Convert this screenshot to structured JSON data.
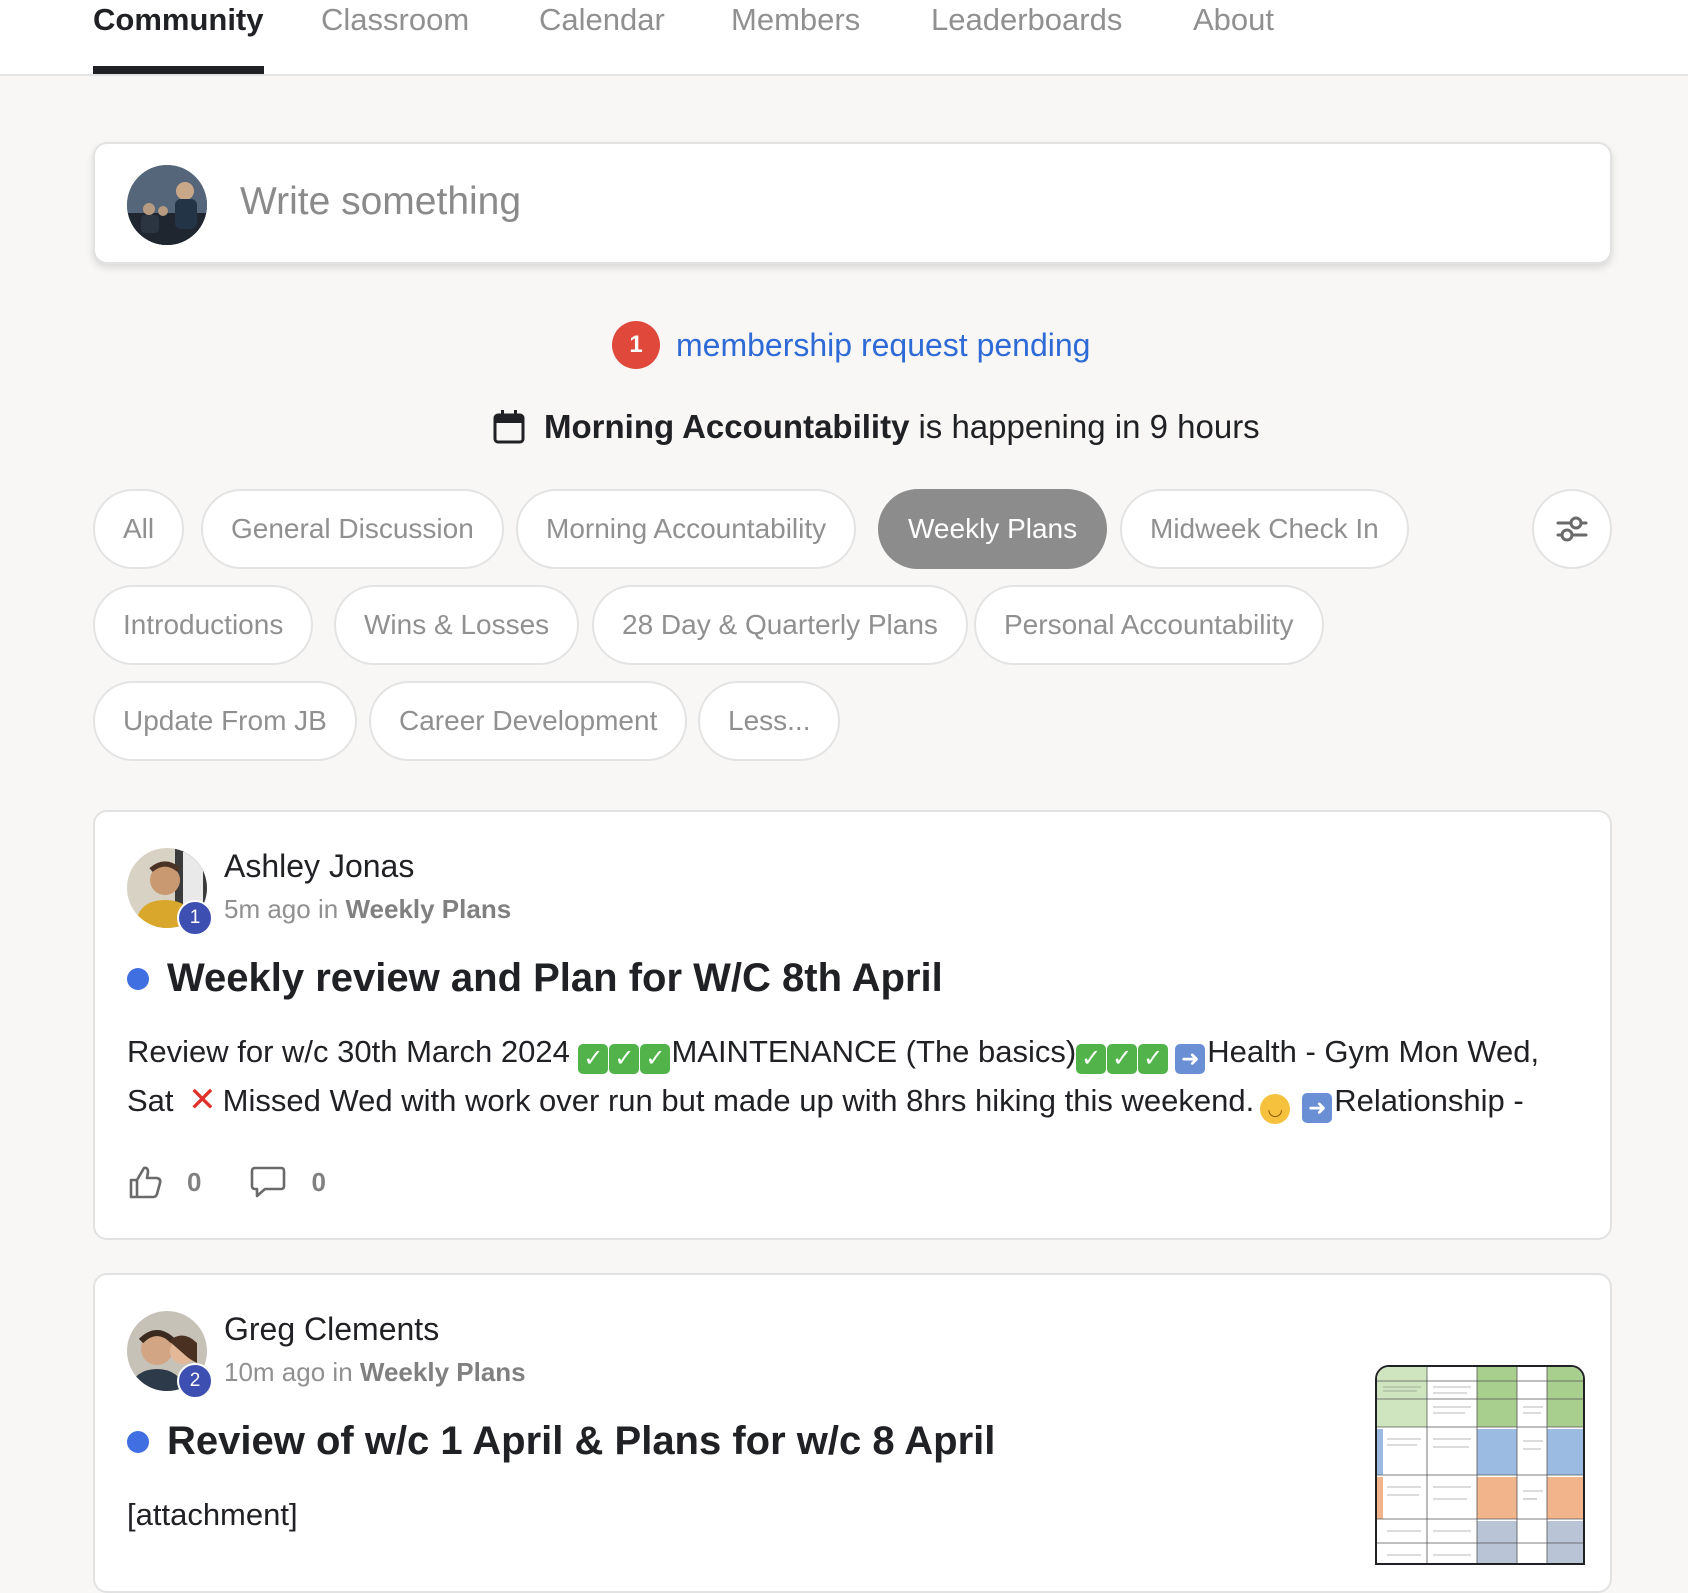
{
  "nav": {
    "tabs": [
      {
        "label": "Community",
        "active": true
      },
      {
        "label": "Classroom",
        "active": false
      },
      {
        "label": "Calendar",
        "active": false
      },
      {
        "label": "Members",
        "active": false
      },
      {
        "label": "Leaderboards",
        "active": false
      },
      {
        "label": "About",
        "active": false
      }
    ]
  },
  "composer": {
    "placeholder": "Write something"
  },
  "pending": {
    "count": "1",
    "text": "membership request pending"
  },
  "event": {
    "name": "Morning Accountability",
    "text": "is happening in 9 hours"
  },
  "categories": [
    {
      "label": "All",
      "active": false
    },
    {
      "label": "General Discussion",
      "active": false
    },
    {
      "label": "Morning Accountability",
      "active": false
    },
    {
      "label": "Weekly Plans",
      "active": true
    },
    {
      "label": "Midweek Check In",
      "active": false
    },
    {
      "label": "Introductions",
      "active": false
    },
    {
      "label": "Wins & Losses",
      "active": false
    },
    {
      "label": "28 Day & Quarterly Plans",
      "active": false
    },
    {
      "label": "Personal Accountability",
      "active": false
    },
    {
      "label": "Update From JB",
      "active": false
    },
    {
      "label": "Career Development",
      "active": false
    },
    {
      "label": "Less...",
      "active": false
    }
  ],
  "posts": [
    {
      "author": "Ashley Jonas",
      "level": "1",
      "time": "5m ago",
      "in": "in",
      "category": "Weekly Plans",
      "title": "Weekly review and Plan for W/C 8th April",
      "body_parts": {
        "p1": "Review for w/c 30th March 2024 ",
        "p2": "MAINTENANCE (The basics)",
        "p3": "Health - Gym Mon Wed,",
        "p4": "Sat ",
        "p5": "Missed Wed with work over run but made up with 8hrs hiking this weekend.",
        "p6": "Relationship -"
      },
      "likes": "0",
      "comments": "0"
    },
    {
      "author": "Greg Clements",
      "level": "2",
      "time": "10m ago",
      "in": "in",
      "category": "Weekly Plans",
      "title": "Review of w/c 1 April & Plans for w/c 8 April",
      "body": "[attachment]"
    }
  ],
  "colors": {
    "accent_blue": "#2e6bd6",
    "badge_red": "#e0483b",
    "active_chip": "#8c8c8c",
    "unread_dot": "#3f6fe0",
    "level_badge": "#3d4fb0"
  },
  "icons": {
    "calendar": "calendar-icon",
    "filter": "sliders-icon",
    "like": "thumbs-up-icon",
    "comment": "comment-icon"
  }
}
